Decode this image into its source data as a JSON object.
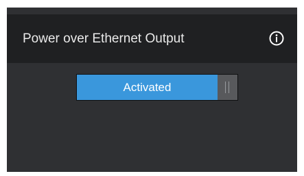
{
  "panel": {
    "title": "Power over Ethernet Output",
    "info_icon": "info-icon"
  },
  "poe_toggle": {
    "label": "Activated",
    "state": "on",
    "accent_color": "#3a97dc"
  }
}
